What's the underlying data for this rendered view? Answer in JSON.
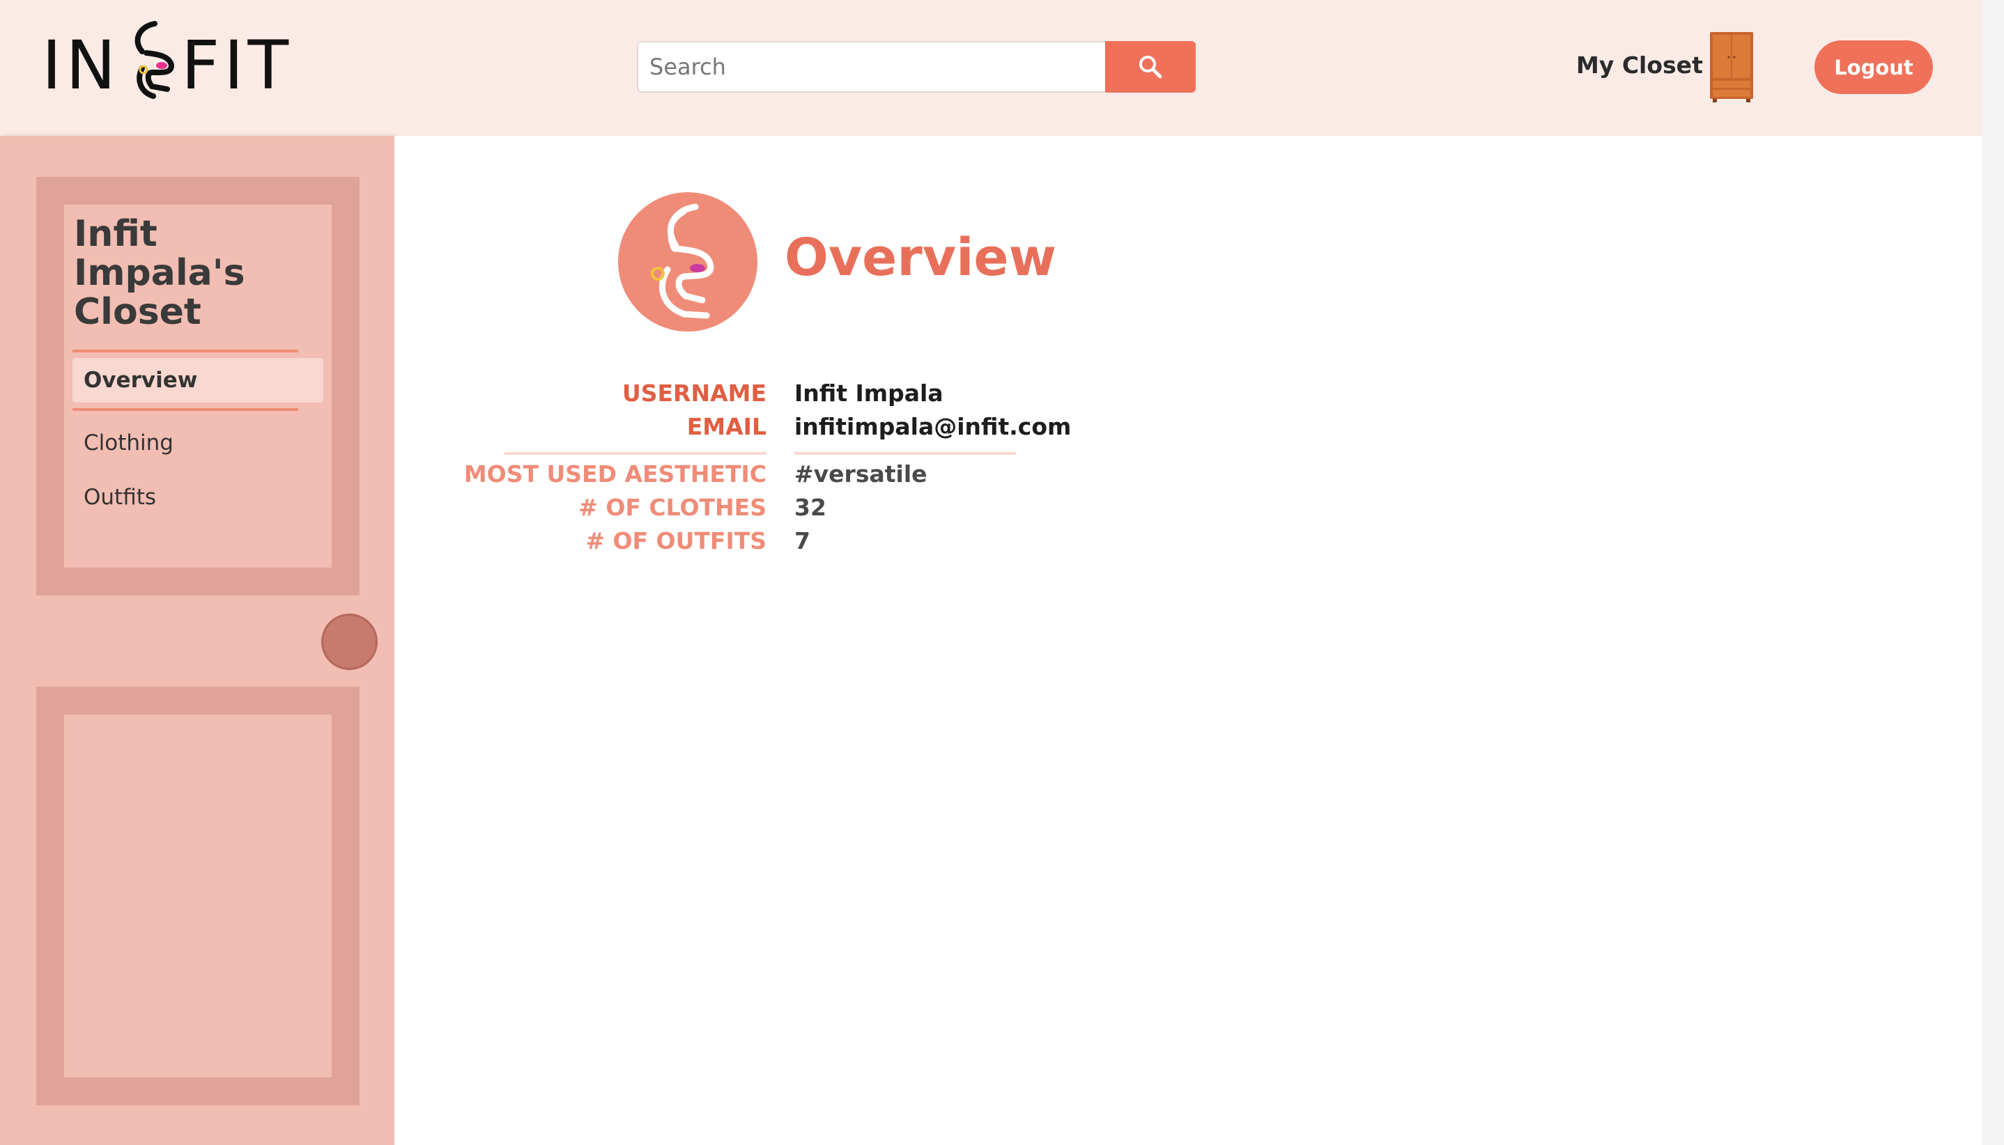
{
  "header": {
    "logo": {
      "left": "IN",
      "right": "FIT"
    },
    "search": {
      "placeholder": "Search"
    },
    "my_closet_label": "My Closet",
    "logout_label": "Logout"
  },
  "sidebar": {
    "title": "Infit Impala's Closet",
    "items": [
      {
        "label": "Overview",
        "active": true
      },
      {
        "label": "Clothing",
        "active": false
      },
      {
        "label": "Outfits",
        "active": false
      }
    ]
  },
  "main": {
    "title": "Overview",
    "profile": {
      "username_label": "USERNAME",
      "username": "Infit Impala",
      "email_label": "EMAIL",
      "email": "infitimpala@infit.com"
    },
    "stats": {
      "aesthetic_label": "MOST USED AESTHETIC",
      "aesthetic": "#versatile",
      "clothes_label": "# OF CLOTHES",
      "clothes": "32",
      "outfits_label": "# OF OUTFITS",
      "outfits": "7"
    }
  },
  "colors": {
    "accent": "#ef7159",
    "header_bg": "#fbebe6",
    "sidebar_bg": "#f2bdb2",
    "panel_border": "#e0a399",
    "title": "#e8705a"
  },
  "icons": [
    "impala-logo-icon",
    "search-icon",
    "wardrobe-icon",
    "impala-avatar-icon",
    "door-knob-icon"
  ]
}
